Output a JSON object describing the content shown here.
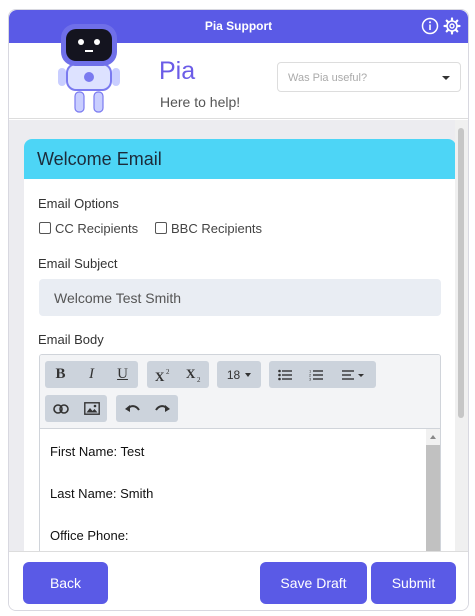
{
  "topbar": {
    "title": "Pia Support"
  },
  "header": {
    "brand": "Pia",
    "tagline": "Here to help!",
    "useful_placeholder": "Was Pia useful?"
  },
  "card": {
    "title": "Welcome Email",
    "email_options_label": "Email Options",
    "cc_label": "CC Recipients",
    "bbc_label": "BBC Recipients",
    "subject_label": "Email Subject",
    "subject_value": "Welcome Test Smith",
    "body_label": "Email Body",
    "font_size": "18",
    "body_lines": [
      "First Name: Test",
      "Last Name: Smith",
      "Office Phone:"
    ]
  },
  "footer": {
    "back": "Back",
    "save_draft": "Save Draft",
    "submit": "Submit"
  },
  "colors": {
    "primary": "#5a5ae6",
    "card_header": "#4dd5f6",
    "brand": "#6b5ce7"
  },
  "icons": [
    "info-icon",
    "gear-icon",
    "robot-logo",
    "bold-icon",
    "italic-icon",
    "underline-icon",
    "superscript-icon",
    "subscript-icon",
    "bullet-list-icon",
    "numbered-list-icon",
    "align-icon",
    "link-icon",
    "image-icon",
    "undo-icon",
    "redo-icon"
  ]
}
